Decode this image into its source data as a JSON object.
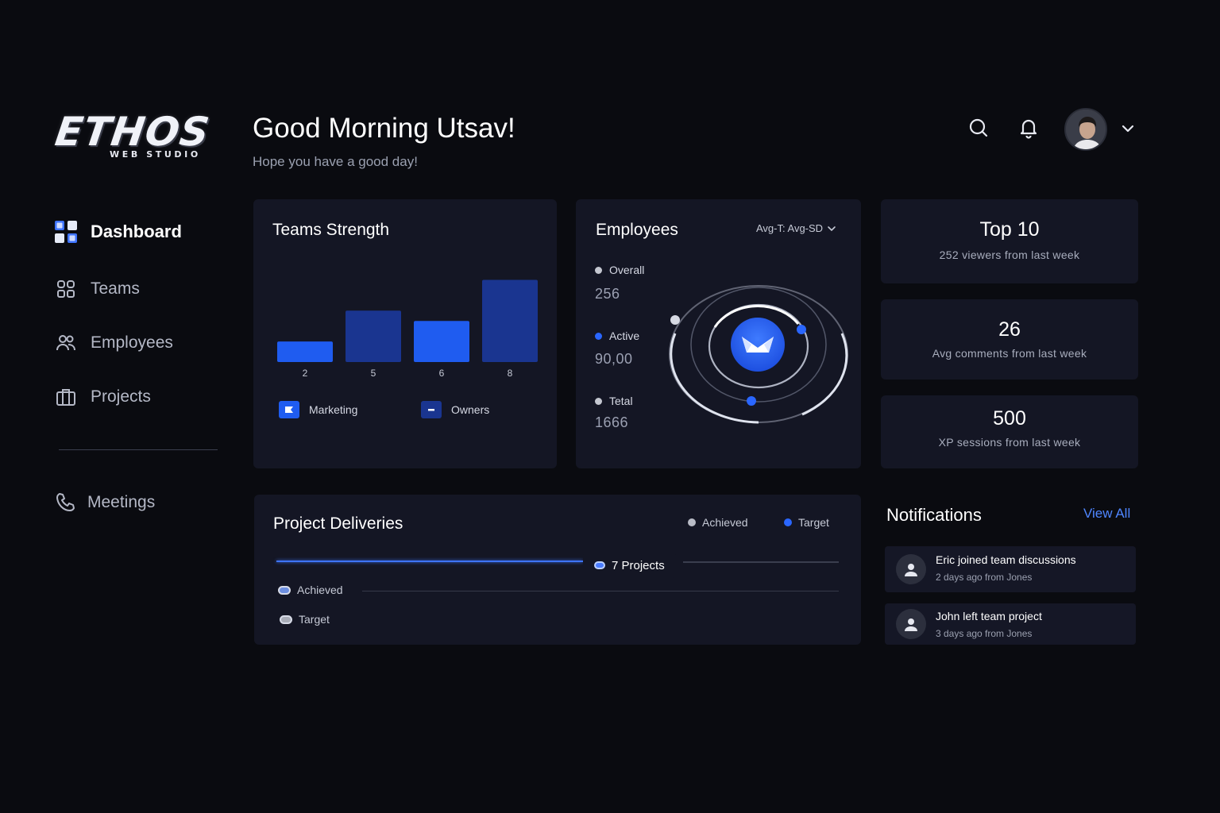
{
  "brand": {
    "logo_text": "ETHOS",
    "logo_sub": "WEB STUDIO"
  },
  "sidebar": {
    "items": [
      {
        "label": "Dashboard",
        "icon": "dashboard-icon",
        "active": true
      },
      {
        "label": "Teams",
        "icon": "teams-icon"
      },
      {
        "label": "Employees",
        "icon": "employees-icon"
      },
      {
        "label": "Projects",
        "icon": "briefcase-icon"
      }
    ],
    "secondary": [
      {
        "label": "Meetings",
        "icon": "phone-icon"
      }
    ]
  },
  "header": {
    "greeting": "Good Morning Utsav!",
    "subtitle": "Hope you have a good day!",
    "icons": [
      "search-icon",
      "bell-icon",
      "avatar",
      "chevron-down-icon"
    ]
  },
  "teams_strength": {
    "title": "Teams Strength",
    "legend": [
      "Marketing",
      "Owners"
    ]
  },
  "chart_data": {
    "type": "bar",
    "categories": [
      "2",
      "5",
      "6",
      "8"
    ],
    "values": [
      2,
      5,
      4,
      8
    ],
    "ylim": [
      0,
      8.5
    ],
    "grid": false,
    "legend": [
      "Marketing",
      "Owners"
    ],
    "colors": [
      "#1f5cf0",
      "#1a3590",
      "#1f5cf0",
      "#1a3590"
    ]
  },
  "employees": {
    "title": "Employees",
    "dropdown": "Avg-T: Avg-SD",
    "stats": [
      {
        "label": "Overall",
        "value": "256",
        "color": "#c4c7d0"
      },
      {
        "label": "Active",
        "value": "90,00",
        "color": "#2a66ff"
      },
      {
        "label": "Tetal",
        "value": "1666",
        "color": "#c4c7d0"
      }
    ]
  },
  "kpis": [
    {
      "value": "Top 10",
      "desc": "252 viewers from last week"
    },
    {
      "value": "26",
      "desc": "Avg comments from last week"
    },
    {
      "value": "500",
      "desc": "XP sessions from last week"
    }
  ],
  "project_deliveries": {
    "title": "Project Deliveries",
    "legend": [
      "Achieved",
      "Target"
    ],
    "tag": "7 Projects",
    "rows": [
      "Achieved",
      "Target"
    ]
  },
  "notifications": {
    "title": "Notifications",
    "view_all": "View All",
    "items": [
      {
        "main": "Eric joined team discussions",
        "sub": "2 days ago from Jones"
      },
      {
        "main": "John left team project",
        "sub": "3 days ago from Jones"
      }
    ]
  },
  "colors": {
    "accent": "#2a66ff",
    "bg": "#0a0b10",
    "card": "#141624"
  }
}
